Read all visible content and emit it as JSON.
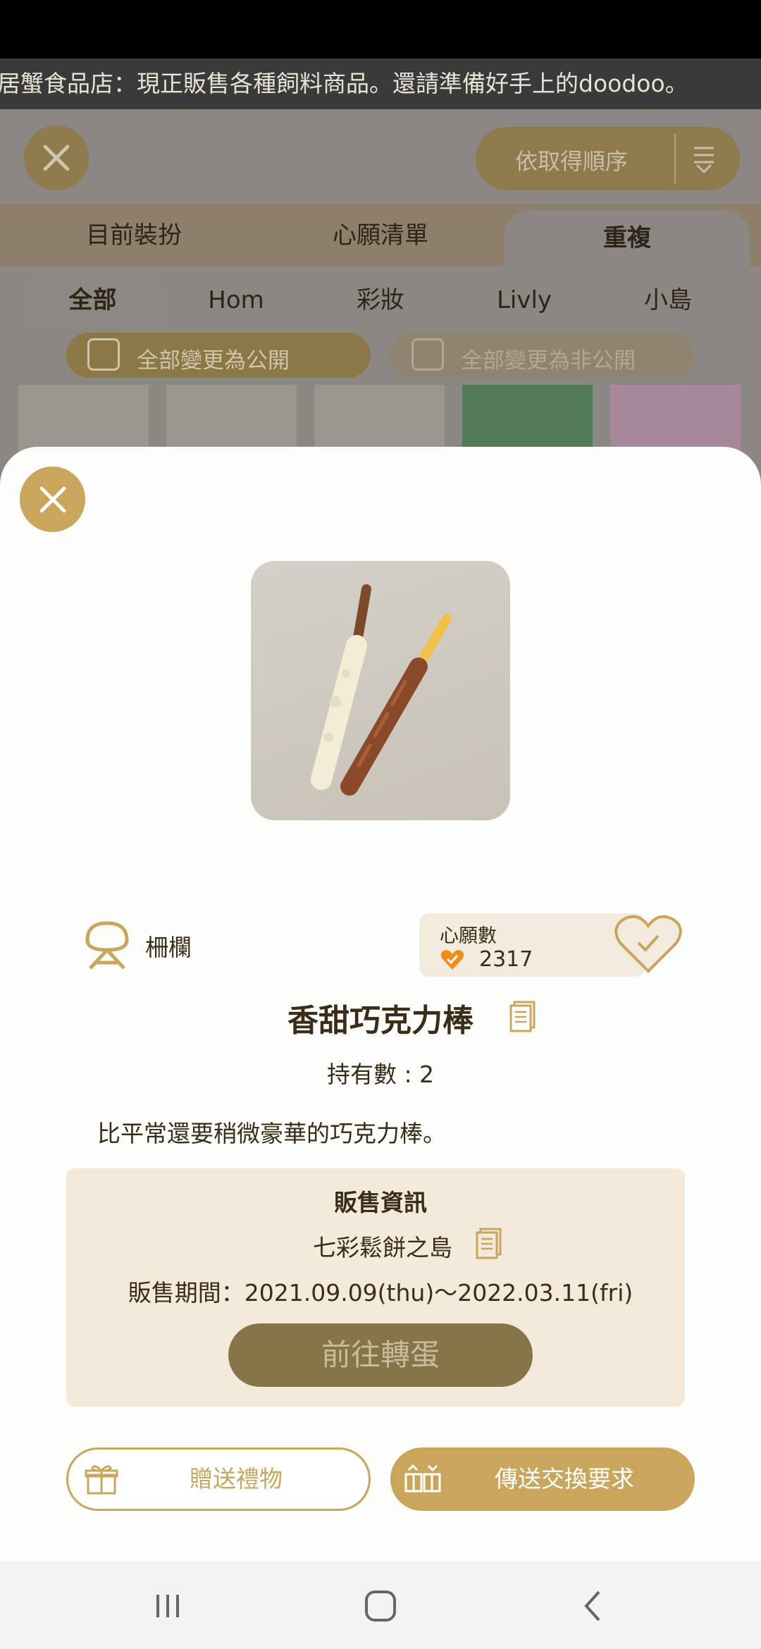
{
  "ticker": {
    "text": "居蟹食品店：現正販售各種飼料商品。還請準備好手上的doodoo。"
  },
  "background": {
    "sort_label": "依取得順序",
    "tabs": [
      "目前裝扮",
      "心願清單",
      "重複"
    ],
    "subtabs": [
      "全部",
      "Hom",
      "彩妝",
      "Livly",
      "小島"
    ],
    "make_public": "全部變更為公開",
    "make_private": "全部變更為非公開"
  },
  "item": {
    "category": "柵欄",
    "wish_label": "心願數",
    "wish_count": "2317",
    "name": "香甜巧克力棒",
    "owned": "持有數 : 2",
    "description": "比平常還要稍微豪華的巧克力棒。"
  },
  "sale": {
    "title": "販售資訊",
    "island": "七彩鬆餅之島",
    "period": "販售期間：2021.09.09(thu)～2022.03.11(fri)",
    "goto_label": "前往轉蛋"
  },
  "actions": {
    "gift_label": "贈送禮物",
    "trade_label": "傳送交換要求"
  },
  "colors": {
    "accent": "#c9a65b",
    "text": "#3a2c16",
    "panel": "#f4eadb"
  },
  "icons": [
    "close-icon",
    "sort-icon",
    "fence-icon",
    "heart-icon",
    "copy-icon",
    "gift-icon",
    "trade-icon",
    "recents-icon",
    "home-icon",
    "back-icon"
  ]
}
